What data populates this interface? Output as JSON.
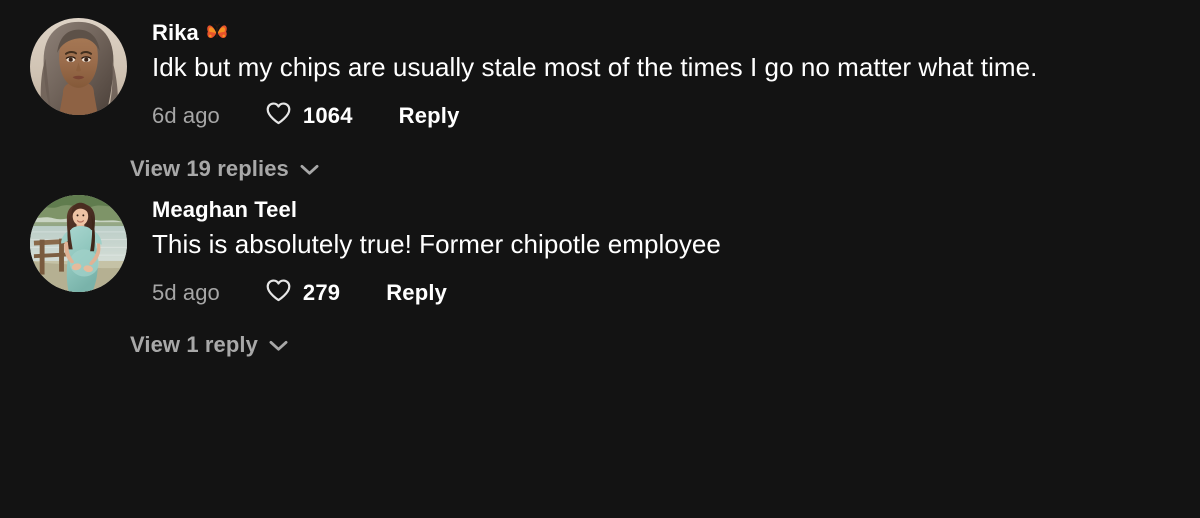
{
  "theme": {
    "background": "#131313",
    "text_primary": "#ffffff",
    "text_secondary": "#a6a6a6",
    "emoji_accent": "#e8532b"
  },
  "comments": [
    {
      "username": "Rika",
      "username_emoji": "butterfly-emoji",
      "avatar": "avatar-photo-rika",
      "text": "Idk but my chips are usually stale most of the times I go no matter what time.",
      "time": "6d ago",
      "like_icon": "heart-icon",
      "likes": "1064",
      "reply_label": "Reply",
      "view_replies_label": "View 19 replies",
      "view_replies_icon": "chevron-down-icon"
    },
    {
      "username": "Meaghan Teel",
      "username_emoji": null,
      "avatar": "avatar-photo-meaghan",
      "text": "This is absolutely true! Former chipotle employee",
      "time": "5d ago",
      "like_icon": "heart-icon",
      "likes": "279",
      "reply_label": "Reply",
      "view_replies_label": "View 1 reply",
      "view_replies_icon": "chevron-down-icon"
    }
  ]
}
